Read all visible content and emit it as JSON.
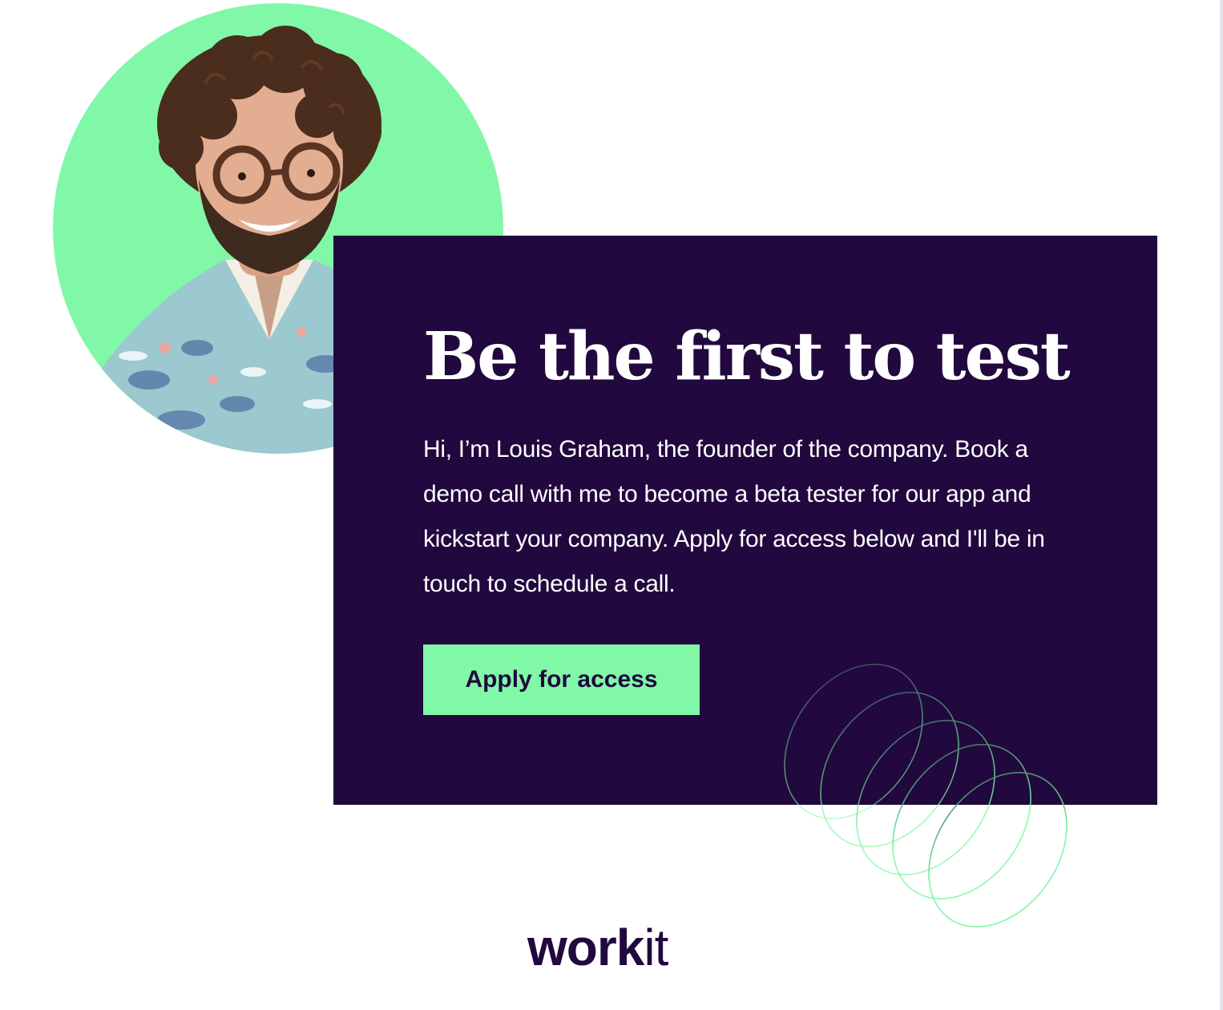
{
  "hero": {
    "headline": "Be the first to test",
    "intro": "Hi, I’m Louis Graham, the founder of the company. Book a demo call with me to become a beta tester for our app and kickstart your company. Apply for access below and I'll be in touch to schedule a call.",
    "cta_label": "Apply for access"
  },
  "brand": {
    "logo_part_bold": "work",
    "logo_part_light": "it"
  },
  "colors": {
    "accent_green": "#80f8a8",
    "card_purple": "#21083e",
    "text_white": "#ffffff"
  },
  "icons": {
    "avatar": "founder-portrait",
    "decoration": "concentric-rings-decoration"
  }
}
